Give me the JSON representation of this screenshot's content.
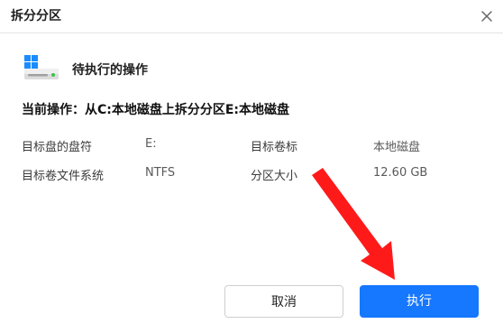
{
  "window": {
    "title": "拆分分区"
  },
  "section": {
    "icon": "drive-icon",
    "title": "待执行的操作"
  },
  "operation": {
    "current_text": "当前操作：从C:本地磁盘上拆分分区E:本地磁盘"
  },
  "details": {
    "target_drive_letter_label": "目标盘的盘符",
    "target_drive_letter_value": "E:",
    "target_volume_label_label": "目标卷标",
    "target_volume_label_value": "本地磁盘",
    "target_fs_label": "目标卷文件系统",
    "target_fs_value": "NTFS",
    "partition_size_label": "分区大小",
    "partition_size_value": "12.60 GB"
  },
  "buttons": {
    "cancel": "取消",
    "execute": "执行"
  },
  "colors": {
    "primary": "#1677ff",
    "annotation_arrow": "#ff1a1a"
  }
}
